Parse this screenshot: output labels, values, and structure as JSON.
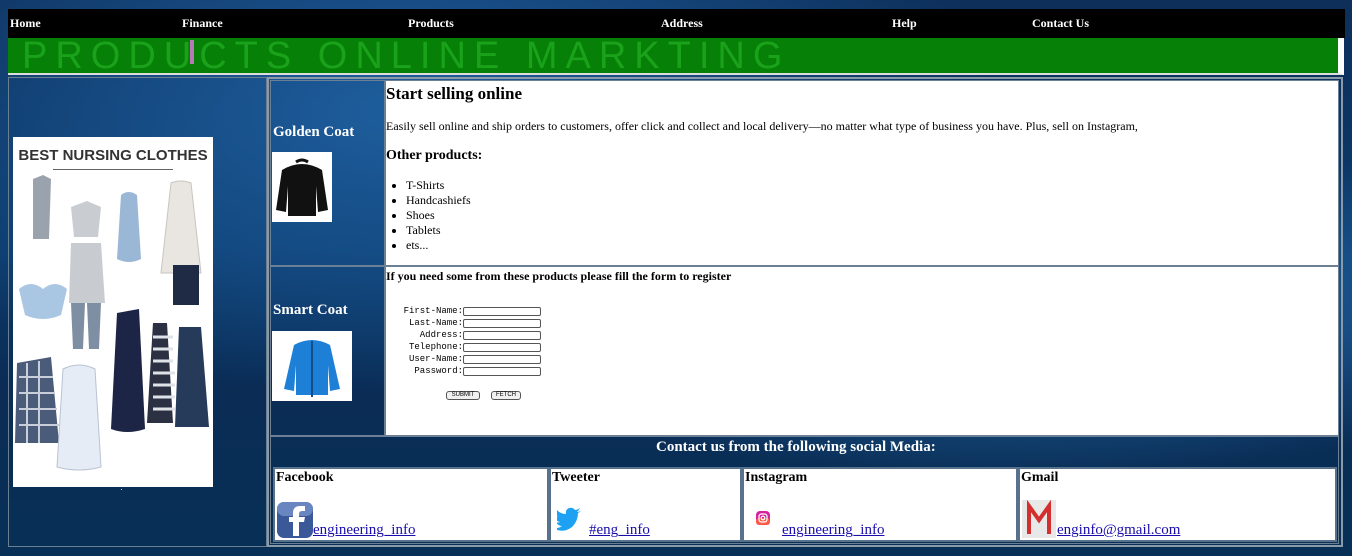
{
  "nav": {
    "items": [
      "Home",
      "Finance",
      "Products",
      "Address",
      "Help",
      "Contact Us"
    ]
  },
  "banner": {
    "text": "PRODUCTS ONLINE MARKTING"
  },
  "sidebar": {
    "image_title": "BEST NURSING CLOTHES"
  },
  "products": [
    {
      "name": "Golden Coat"
    },
    {
      "name": "Smart Coat"
    }
  ],
  "intro": {
    "heading": "Start selling online",
    "body": "Easily sell online and ship orders to customers, offer click and collect and local delivery—no matter what type of business you have. Plus, sell on Instagram,",
    "subheading": "Other products:",
    "items": [
      "T-Shirts",
      "Handcashiefs",
      "Shoes",
      "Tablets",
      "ets..."
    ]
  },
  "form": {
    "lead": "If you need some from these products please fill the form to register",
    "fields": [
      "First-Name:",
      "Last-Name:",
      "Address:",
      "Telephone:",
      "User-Name:",
      "Password:"
    ],
    "submit_label": "SUBMIT",
    "fetch_label": "FETCH"
  },
  "contact": {
    "title": "Contact us from the following social Media:",
    "channels": [
      {
        "name": "Facebook",
        "handle": "engineering_info",
        "icon": "facebook-icon",
        "color": "#3b5998"
      },
      {
        "name": "Tweeter",
        "handle": "#eng_info",
        "icon": "twitter-icon",
        "color": "#1da1f2"
      },
      {
        "name": "Instagram",
        "handle": "engineering_info",
        "icon": "instagram-icon",
        "color": "#d6249f"
      },
      {
        "name": "Gmail",
        "handle": "enginfo@gmail.com",
        "icon": "gmail-icon",
        "color": "#d32f2f"
      }
    ]
  },
  "colors": {
    "navbar": "#000000",
    "banner": "#078007",
    "link": "#1a0dab"
  }
}
